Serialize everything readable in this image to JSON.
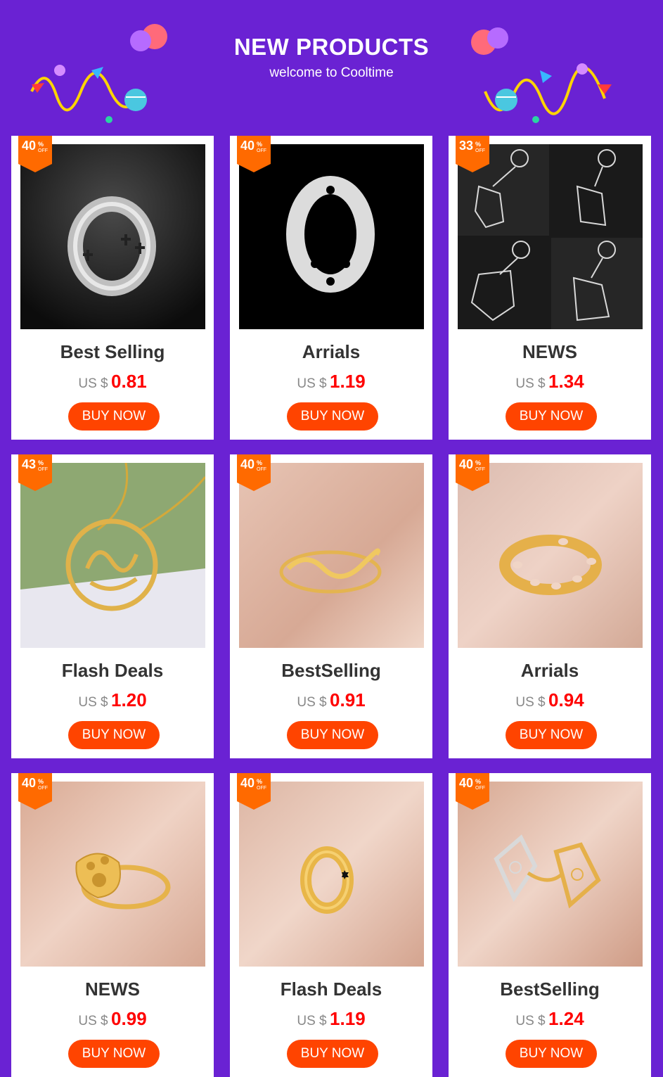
{
  "header": {
    "title": "NEW PRODUCTS",
    "subtitle": "welcome to Cooltime"
  },
  "products": [
    {
      "discount": "40",
      "pct": "%",
      "off": "OFF",
      "title": "Best Selling",
      "currency": "US $",
      "price": "0.81",
      "button": "BUY NOW",
      "image": "cross-ring-icon"
    },
    {
      "discount": "40",
      "pct": "%",
      "off": "OFF",
      "title": "Arrials",
      "currency": "US $",
      "price": "1.19",
      "button": "BUY NOW",
      "image": "heart-ring-icon"
    },
    {
      "discount": "33",
      "pct": "%",
      "off": "OFF",
      "title": "NEWS",
      "currency": "US $",
      "price": "1.34",
      "button": "BUY NOW",
      "image": "animal-keychains-icon"
    },
    {
      "discount": "43",
      "pct": "%",
      "off": "OFF",
      "title": "Flash Deals",
      "currency": "US $",
      "price": "1.20",
      "button": "BUY NOW",
      "image": "pendant-necklace-icon"
    },
    {
      "discount": "40",
      "pct": "%",
      "off": "OFF",
      "title": "BestSelling",
      "currency": "US $",
      "price": "0.91",
      "button": "BUY NOW",
      "image": "infinity-ring-icon"
    },
    {
      "discount": "40",
      "pct": "%",
      "off": "OFF",
      "title": "Arrials",
      "currency": "US $",
      "price": "0.94",
      "button": "BUY NOW",
      "image": "chain-ring-icon"
    },
    {
      "discount": "40",
      "pct": "%",
      "off": "OFF",
      "title": "NEWS",
      "currency": "US $",
      "price": "0.99",
      "button": "BUY NOW",
      "image": "paw-ring-icon"
    },
    {
      "discount": "40",
      "pct": "%",
      "off": "OFF",
      "title": "Flash Deals",
      "currency": "US $",
      "price": "1.19",
      "button": "BUY NOW",
      "image": "star-band-ring-icon"
    },
    {
      "discount": "40",
      "pct": "%",
      "off": "OFF",
      "title": "BestSelling",
      "currency": "US $",
      "price": "1.24",
      "button": "BUY NOW",
      "image": "filigree-ring-icon"
    }
  ]
}
